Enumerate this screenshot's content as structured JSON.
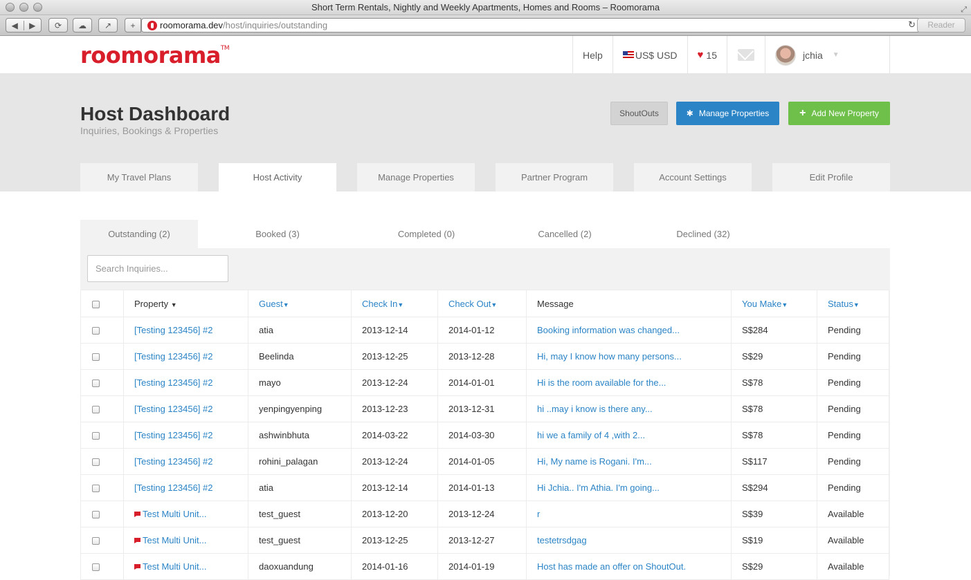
{
  "browser": {
    "window_title": "Short Term Rentals, Nightly and Weekly Apartments, Homes and Rooms – Roomorama",
    "url_domain": "roomorama.dev",
    "url_path": "/host/inquiries/outstanding",
    "reader_label": "Reader"
  },
  "header": {
    "logo": "roomorama",
    "logo_tm": "TM",
    "help": "Help",
    "currency": "US$ USD",
    "favorites_count": "15",
    "username": "jchia"
  },
  "dashboard": {
    "title": "Host Dashboard",
    "subtitle": "Inquiries, Bookings & Properties",
    "buttons": {
      "shoutouts": "ShoutOuts",
      "manage": "Manage Properties",
      "add": "Add New Property"
    },
    "tabs": [
      "My Travel Plans",
      "Host Activity",
      "Manage Properties",
      "Partner Program",
      "Account Settings",
      "Edit Profile"
    ]
  },
  "subtabs": [
    "Outstanding (2)",
    "Booked (3)",
    "Completed (0)",
    "Cancelled (2)",
    "Declined (32)"
  ],
  "search": {
    "placeholder": "Search Inquiries..."
  },
  "table": {
    "headers": {
      "property": "Property",
      "guest": "Guest",
      "check_in": "Check In",
      "check_out": "Check Out",
      "message": "Message",
      "you_make": "You Make",
      "status": "Status"
    },
    "rows": [
      {
        "property": "[Testing 123456] #2",
        "guest": "atia",
        "check_in": "2013-12-14",
        "check_out": "2014-01-12",
        "message": "Booking information was changed...",
        "you_make": "S$284",
        "status": "Pending"
      },
      {
        "property": "[Testing 123456] #2",
        "guest": "Beelinda",
        "check_in": "2013-12-25",
        "check_out": "2013-12-28",
        "message": "Hi, may I know how many persons...",
        "you_make": "S$29",
        "status": "Pending"
      },
      {
        "property": "[Testing 123456] #2",
        "guest": "mayo",
        "check_in": "2013-12-24",
        "check_out": "2014-01-01",
        "message": "Hi is the room available for the...",
        "you_make": "S$78",
        "status": "Pending"
      },
      {
        "property": "[Testing 123456] #2",
        "guest": "yenpingyenping",
        "check_in": "2013-12-23",
        "check_out": "2013-12-31",
        "message": "hi ..may i know is there any...",
        "you_make": "S$78",
        "status": "Pending"
      },
      {
        "property": "[Testing 123456] #2",
        "guest": "ashwinbhuta",
        "check_in": "2014-03-22",
        "check_out": "2014-03-30",
        "message": "hi we a family of 4 ,with 2...",
        "you_make": "S$78",
        "status": "Pending"
      },
      {
        "property": "[Testing 123456] #2",
        "guest": "rohini_palagan",
        "check_in": "2013-12-24",
        "check_out": "2014-01-05",
        "message": "Hi, My name is Rogani. I'm...",
        "you_make": "S$117",
        "status": "Pending"
      },
      {
        "property": "[Testing 123456] #2",
        "guest": "atia",
        "check_in": "2013-12-14",
        "check_out": "2014-01-13",
        "message": "Hi Jchia.. I'm Athia. I'm going...",
        "you_make": "S$294",
        "status": "Pending"
      },
      {
        "property": "Test Multi Unit...",
        "guest": "test_guest",
        "check_in": "2013-12-20",
        "check_out": "2013-12-24",
        "message": "r",
        "you_make": "S$39",
        "status": "Available",
        "flag": true
      },
      {
        "property": "Test Multi Unit...",
        "guest": "test_guest",
        "check_in": "2013-12-25",
        "check_out": "2013-12-27",
        "message": "testetrsdgag",
        "you_make": "S$19",
        "status": "Available",
        "flag": true
      },
      {
        "property": "Test Multi Unit...",
        "guest": "daoxuandung",
        "check_in": "2014-01-16",
        "check_out": "2014-01-19",
        "message": "Host has made an offer on ShoutOut.",
        "you_make": "S$29",
        "status": "Available",
        "flag": true
      }
    ]
  }
}
